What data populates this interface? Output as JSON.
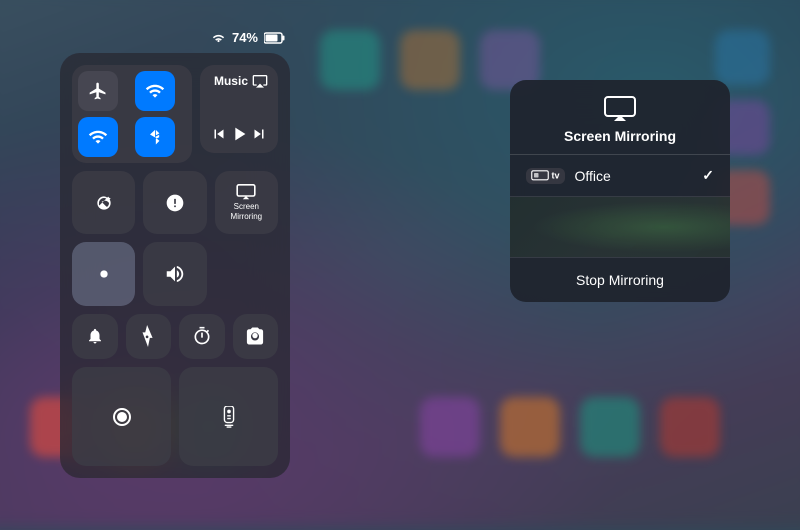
{
  "statusBar": {
    "wifi": "wifi",
    "battery": "74%",
    "batteryIcon": "🔋"
  },
  "controlCenter": {
    "networkGroup": {
      "airplane": {
        "label": "airplane-mode",
        "active": false
      },
      "cellular": {
        "label": "cellular",
        "active": true
      },
      "wifi": {
        "label": "wifi",
        "active": true
      },
      "bluetooth": {
        "label": "bluetooth",
        "active": true
      }
    },
    "music": {
      "title": "Music",
      "prev": "⏮",
      "play": "▶",
      "next": "⏭",
      "airplay": "airplay"
    },
    "row2": {
      "orientation": "orientation-lock",
      "doNotDisturb": "do-not-disturb",
      "screenMirror": "Screen\nMirroring"
    },
    "row3": {
      "brightness": "brightness",
      "volume": "volume"
    },
    "row4": {
      "bell": "bell",
      "flashlight": "flashlight",
      "timer": "timer",
      "camera": "camera"
    },
    "row5": {
      "record": "screen-record",
      "remote": "remote"
    }
  },
  "screenMirroring": {
    "title": "Screen Mirroring",
    "iconLabel": "screen-mirroring-icon",
    "devices": [
      {
        "name": "Office",
        "badge": "tv",
        "selected": true
      }
    ],
    "stopButton": "Stop Mirroring"
  },
  "colors": {
    "accent": "#007AFF",
    "background": "#2a3a50",
    "controlBg": "rgba(40,40,50,0.75)",
    "btnBg": "rgba(60,60,70,0.8)"
  }
}
